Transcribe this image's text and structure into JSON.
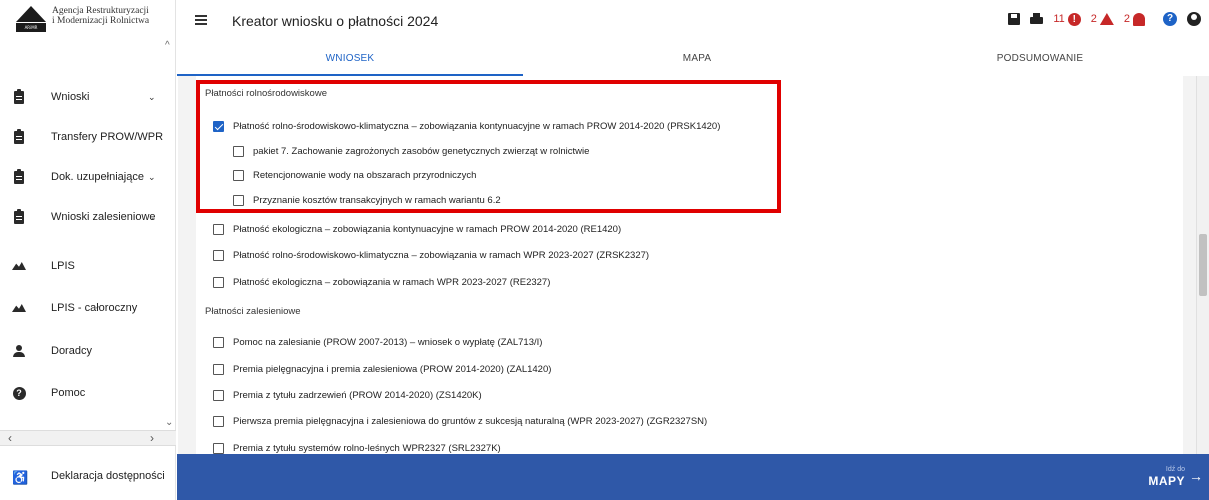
{
  "brand": {
    "line1": "Agencja Restrukturyzacji",
    "line2": "i Modernizacji Rolnictwa",
    "mark_text": "ARiMR"
  },
  "sidebar": {
    "items": [
      {
        "label": "Wnioski",
        "icon": "clipboard-icon",
        "chevron": "⌄"
      },
      {
        "label": "Transfery PROW/WPR",
        "icon": "clipboard-icon",
        "chevron": ""
      },
      {
        "label": "Dok. uzupełniające",
        "icon": "clipboard-icon",
        "chevron": "⌄"
      },
      {
        "label": "Wnioski zalesieniowe",
        "icon": "clipboard-icon",
        "chevron": "⌄"
      },
      {
        "label": "LPIS",
        "icon": "terrain-icon",
        "chevron": ""
      },
      {
        "label": "LPIS - całoroczny",
        "icon": "terrain-icon",
        "chevron": ""
      },
      {
        "label": "Doradcy",
        "icon": "person-icon",
        "chevron": ""
      },
      {
        "label": "Pomoc",
        "icon": "help-icon",
        "chevron": ""
      }
    ],
    "accessibility_label": "Deklaracja dostępności"
  },
  "header": {
    "title": "Kreator wniosku o płatności 2024",
    "error_count": "11",
    "warning_count": "2",
    "notification_count": "2"
  },
  "tabs": [
    {
      "label": "WNIOSEK",
      "active": true
    },
    {
      "label": "MAPA",
      "active": false
    },
    {
      "label": "PODSUMOWANIE",
      "active": false
    }
  ],
  "sections": {
    "agri": {
      "heading": "Płatności rolnośrodowiskowe",
      "items": [
        {
          "label": "Płatność rolno-środowiskowo-klimatyczna – zobowiązania kontynuacyjne w ramach PROW 2014-2020 (PRSK1420)",
          "checked": true
        },
        {
          "label": "pakiet 7. Zachowanie zagrożonych zasobów genetycznych zwierząt w rolnictwie",
          "checked": false
        },
        {
          "label": "Retencjonowanie wody na obszarach przyrodniczych",
          "checked": false
        },
        {
          "label": "Przyznanie kosztów transakcyjnych w ramach wariantu 6.2",
          "checked": false
        },
        {
          "label": "Płatność ekologiczna – zobowiązania kontynuacyjne w ramach PROW 2014-2020 (RE1420)",
          "checked": false
        },
        {
          "label": "Płatność rolno-środowiskowo-klimatyczna – zobowiązania w ramach WPR 2023-2027 (ZRSK2327)",
          "checked": false
        },
        {
          "label": "Płatność ekologiczna – zobowiązania w ramach WPR 2023-2027 (RE2327)",
          "checked": false
        }
      ]
    },
    "forest": {
      "heading": "Płatności zalesieniowe",
      "items": [
        {
          "label": "Pomoc na zalesianie (PROW 2007-2013) – wniosek o wypłatę (ZAL713/I)",
          "checked": false
        },
        {
          "label": "Premia pielęgnacyjna i premia zalesieniowa (PROW 2014-2020) (ZAL1420)",
          "checked": false
        },
        {
          "label": "Premia z tytułu zadrzewień (PROW 2014-2020) (ZS1420K)",
          "checked": false
        },
        {
          "label": "Pierwsza premia pielęgnacyjna i zalesieniowa do gruntów z sukcesją naturalną (WPR 2023-2027) (ZGR2327SN)",
          "checked": false
        },
        {
          "label": "Premia z tytułu systemów rolno-leśnych WPR2327 (SRL2327K)",
          "checked": false
        }
      ]
    }
  },
  "footer": {
    "go_small": "Idź do",
    "go_big": "MAPY",
    "arrow": "→"
  },
  "colors": {
    "accent": "#1e63c6",
    "error": "#c62828",
    "highlight": "#e00000",
    "footer_bg": "#2f58a8"
  }
}
